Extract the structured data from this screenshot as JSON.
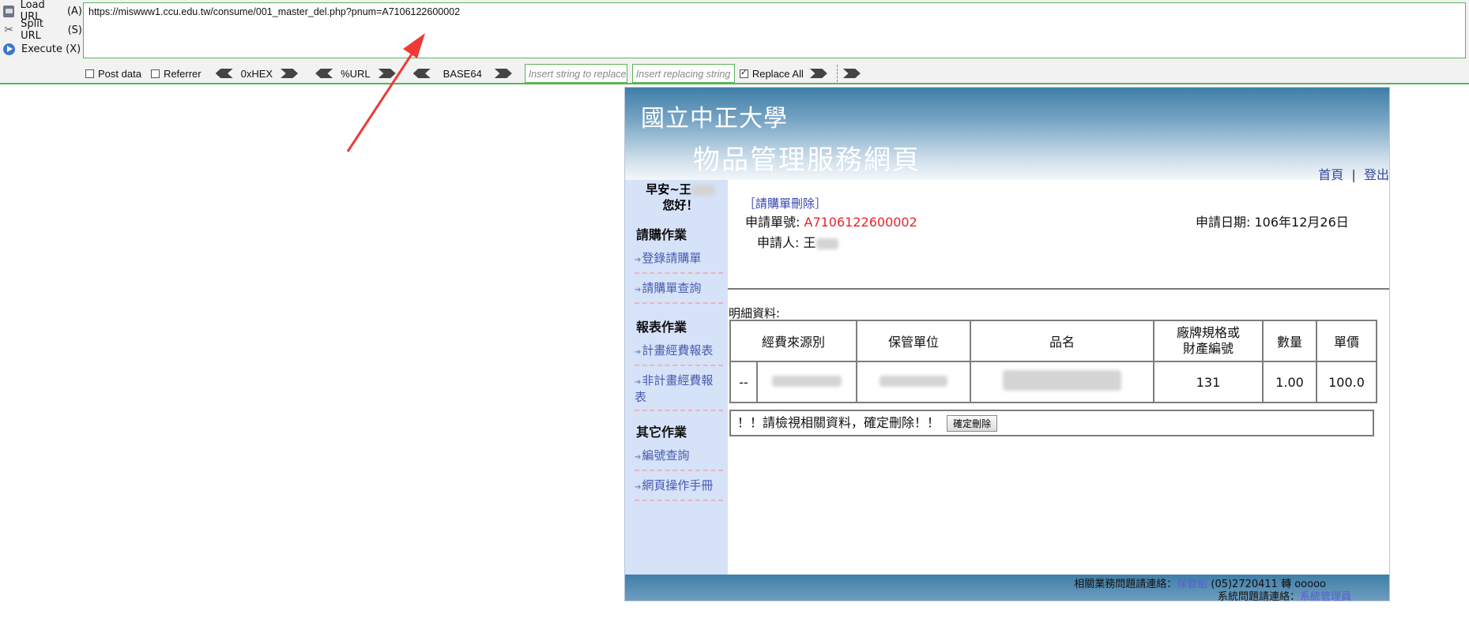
{
  "hackbar": {
    "commands": [
      {
        "label": "Load URL",
        "key": "(A)",
        "icon": "load-url-icon"
      },
      {
        "label": "Split URL",
        "key": "(S)",
        "icon": "split-url-icon"
      },
      {
        "label": "Execute",
        "key": "(X)",
        "icon": "execute-icon"
      }
    ],
    "url": "https://miswww1.ccu.edu.tw/consume/001_master_del.php?pnum=A7106122600002",
    "options": {
      "post_data": "Post data",
      "referrer": "Referrer",
      "hex": "0xHEX",
      "url_enc": "%URL",
      "base64": "BASE64",
      "insert_placeholder": "Insert string to replace",
      "replacing_placeholder": "Insert replacing string",
      "replace_all": "Replace All"
    },
    "accent_color": "#5ab35a"
  },
  "page": {
    "university": "國立中正大學",
    "system_name": "物品管理服務網頁",
    "nav": {
      "home": "首頁",
      "sep": "|",
      "logout": "登出"
    },
    "greeting_line1": "早安~王",
    "greeting_line2": "您好！",
    "sidebar": {
      "sec1": "請購作業",
      "link1": "登錄請購單",
      "link2": "請購單查詢",
      "sec2": "報表作業",
      "link3": "計畫經費報表",
      "link4": "非計畫經費報表",
      "sec3": "其它作業",
      "link5": "編號查詢",
      "link6": "網頁操作手冊"
    },
    "content": {
      "title": "［請購單刪除］",
      "order_no_label": "申請單號:",
      "order_no": "A7106122600002",
      "date_label": "申請日期:",
      "date": "106年12月26日",
      "applicant_label": "申請人:",
      "applicant": "王",
      "detail_label": "明細資料:",
      "table": {
        "headers": [
          "經費來源別",
          "保管單位",
          "品名",
          "廠牌規格或財產編號",
          "數量",
          "單價"
        ],
        "header_spec_l1": "廠牌規格或",
        "header_spec_l2": "財產編號",
        "row": {
          "idx": "--",
          "spec": "131",
          "qty": "1.00",
          "price": "100.0"
        }
      },
      "confirm_text": "！！請檢視相關資料，確定刪除！！",
      "confirm_button": "確定刪除"
    },
    "footer": {
      "line1_prefix": "相關業務問題請連絡：",
      "line1_link": "保管組",
      "line1_suffix": "(05)2720411 轉 ooooo",
      "line2_prefix": "系統問題請連絡：",
      "line2_link": "系統管理員"
    }
  }
}
